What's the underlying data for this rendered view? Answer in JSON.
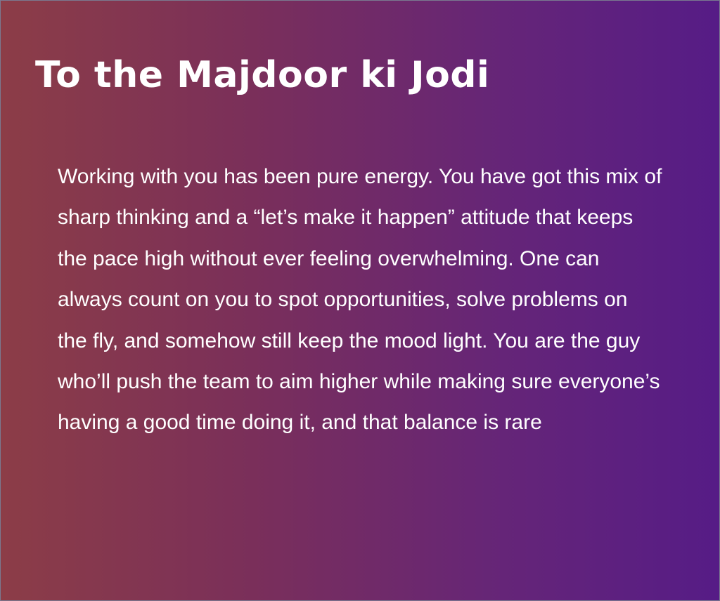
{
  "card": {
    "title": "To the Majdoor ki Jodi",
    "message": "Working with you has been pure energy. You have got this mix of sharp thinking and a “let’s make it happen” attitude that keeps the pace high without ever feeling overwhelming. One can always count on you to spot opportunities, solve problems on the fly, and somehow still keep the mood light. You are the guy who’ll push the team to aim higher while making sure everyone’s having a good time doing it, and that balance is rare",
    "colors": {
      "gradient_start": "#8c3d47",
      "gradient_mid": "#7a2f5a",
      "gradient_end": "#561c86",
      "text": "#ffffff"
    }
  }
}
